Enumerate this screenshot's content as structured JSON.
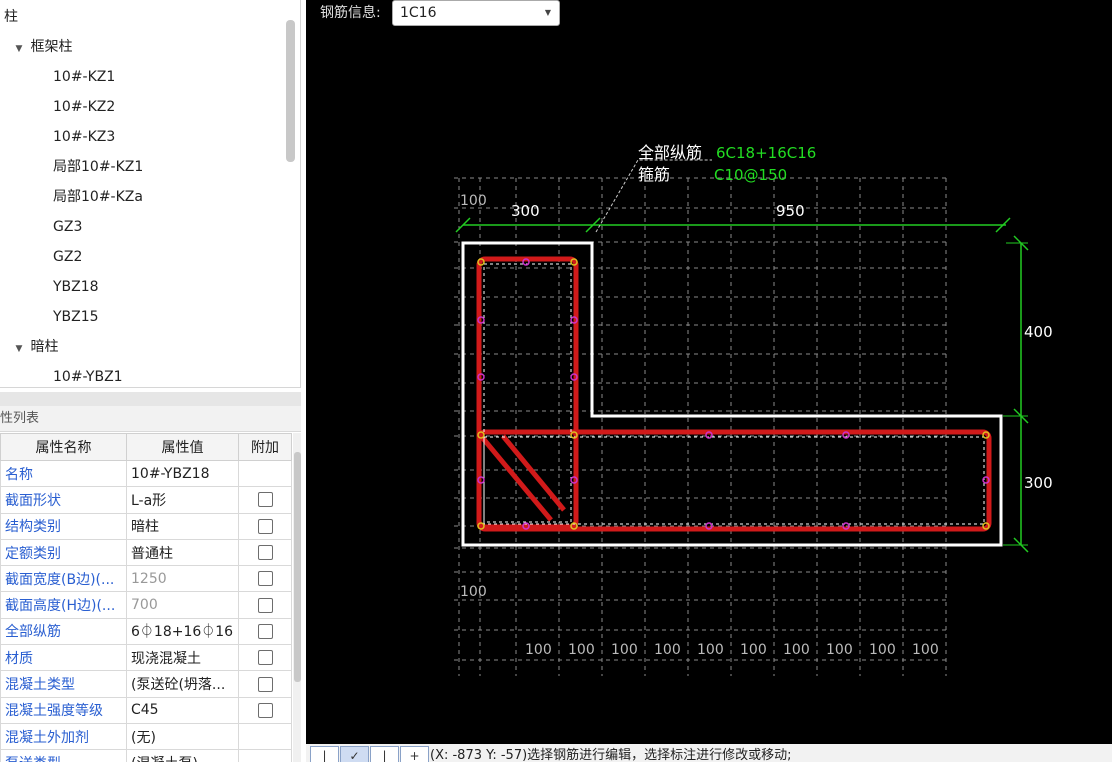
{
  "tree": {
    "root": "柱",
    "groups": [
      {
        "label": "框架柱",
        "items": [
          "10#-KZ1",
          "10#-KZ2",
          "10#-KZ3",
          "局部10#-KZ1",
          "局部10#-KZa",
          "GZ3",
          "GZ2",
          "YBZ18",
          "YBZ15"
        ]
      },
      {
        "label": "暗柱",
        "items": [
          "10#-YBZ1"
        ]
      }
    ]
  },
  "properties": {
    "title": "性列表",
    "headers": {
      "name": "属性名称",
      "value": "属性值",
      "extra": "附加"
    },
    "rows": [
      {
        "name": "名称",
        "value": "10#-YBZ18",
        "checkbox": false,
        "gray": false
      },
      {
        "name": "截面形状",
        "value": "L-a形",
        "checkbox": true,
        "gray": false
      },
      {
        "name": "结构类别",
        "value": "暗柱",
        "checkbox": true,
        "gray": false
      },
      {
        "name": "定额类别",
        "value": "普通柱",
        "checkbox": true,
        "gray": false
      },
      {
        "name": "截面宽度(B边)(...",
        "value": "1250",
        "checkbox": true,
        "gray": true
      },
      {
        "name": "截面高度(H边)(...",
        "value": "700",
        "checkbox": true,
        "gray": true
      },
      {
        "name": "全部纵筋",
        "value": "6⏀18+16⏀16",
        "checkbox": true,
        "gray": false
      },
      {
        "name": "材质",
        "value": "现浇混凝土",
        "checkbox": true,
        "gray": false
      },
      {
        "name": "混凝土类型",
        "value": "(泵送砼(坍落...",
        "checkbox": true,
        "gray": false
      },
      {
        "name": "混凝土强度等级",
        "value": "C45",
        "checkbox": true,
        "gray": false
      },
      {
        "name": "混凝土外加剂",
        "value": "(无)",
        "checkbox": false,
        "gray": false
      },
      {
        "name": "泵送类型",
        "value": "(混凝土泵)",
        "checkbox": false,
        "gray": false
      }
    ]
  },
  "canvas": {
    "rebar_info_label": "钢筋信息:",
    "rebar_info_value": "1C16",
    "annotation": {
      "all_long_label": "全部纵筋",
      "all_long_value": "6C18+16C16",
      "stirrup_label": "箍筋",
      "stirrup_value": "C10@150"
    },
    "dimensions": {
      "top_left": "300",
      "top_right": "950",
      "right_upper": "400",
      "right_lower": "300",
      "grid_label": "100"
    },
    "colors": {
      "background": "#000000",
      "outline": "#ffffff",
      "stirrup": "#d11a1a",
      "dimension": "#22cc22",
      "grid": "#8a8a8a",
      "rebar_dot": "#cc33cc"
    }
  },
  "toolbar": {
    "buttons": [
      "|",
      "✓",
      "|",
      "+"
    ],
    "status": "(X: -873 Y: -57)选择钢筋进行编辑，选择标注进行修改或移动;"
  }
}
